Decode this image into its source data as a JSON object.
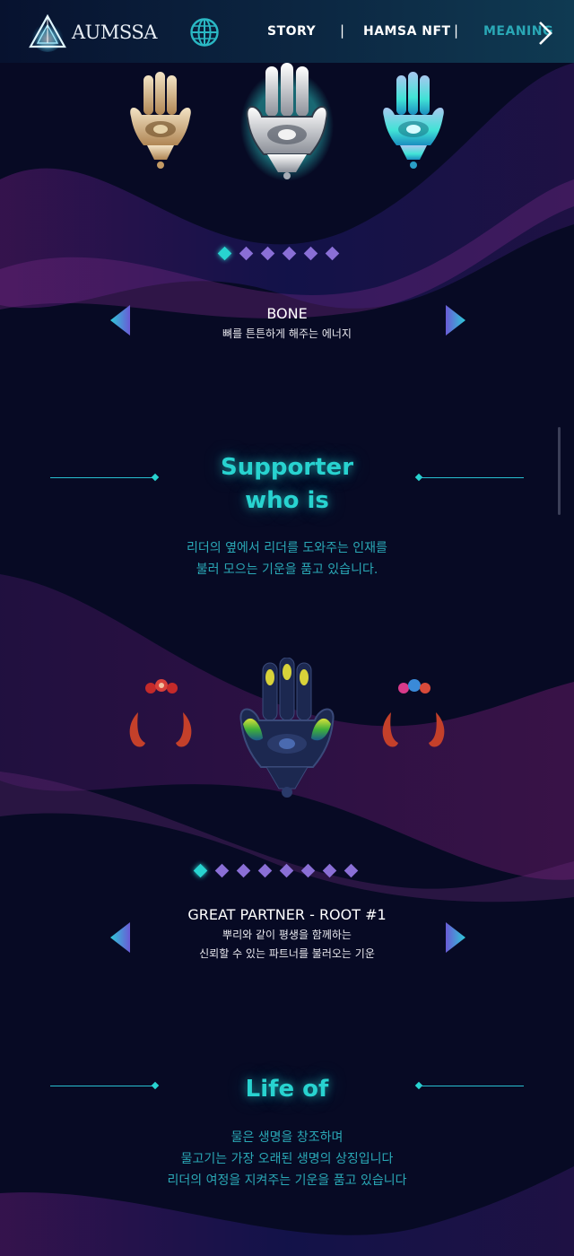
{
  "header": {
    "logo_text": "AUMSSA",
    "nav": {
      "story": "STORY",
      "separator": "|",
      "hamsa_nft": "HAMSA NFT",
      "meaning": "MEANING"
    }
  },
  "carousel_top": {
    "title": "BONE",
    "subtitle": "뼈를 튼튼하게 해주는 에너지",
    "dot_count": 6,
    "active_dot": 0
  },
  "supporter_section": {
    "title_line1": "Supporter",
    "title_line2": "who is",
    "desc_line1": "리더의 옆에서 리더를 도와주는 인재를",
    "desc_line2": "불러 모으는 기운을 품고 있습니다."
  },
  "carousel_partner": {
    "title": "GREAT PARTNER - ROOT #1",
    "subtitle_line1": "뿌리와 같이 평생을 함께하는",
    "subtitle_line2": "신뢰할 수 있는 파트너를 불러오는 기운",
    "dot_count": 8,
    "active_dot": 0
  },
  "life_section": {
    "title": "Life of",
    "desc_line1": "물은 생명을 창조하며",
    "desc_line2": "물고기는 가장 오래된 생명의 상징입니다",
    "desc_line3": "리더의 여정을 지켜주는 기운을 품고 있습니다"
  },
  "colors": {
    "background": "#070a24",
    "accent_teal": "#28d3d0",
    "dot_purple": "#8a6fd6",
    "desc_teal": "#2aa8b6"
  }
}
